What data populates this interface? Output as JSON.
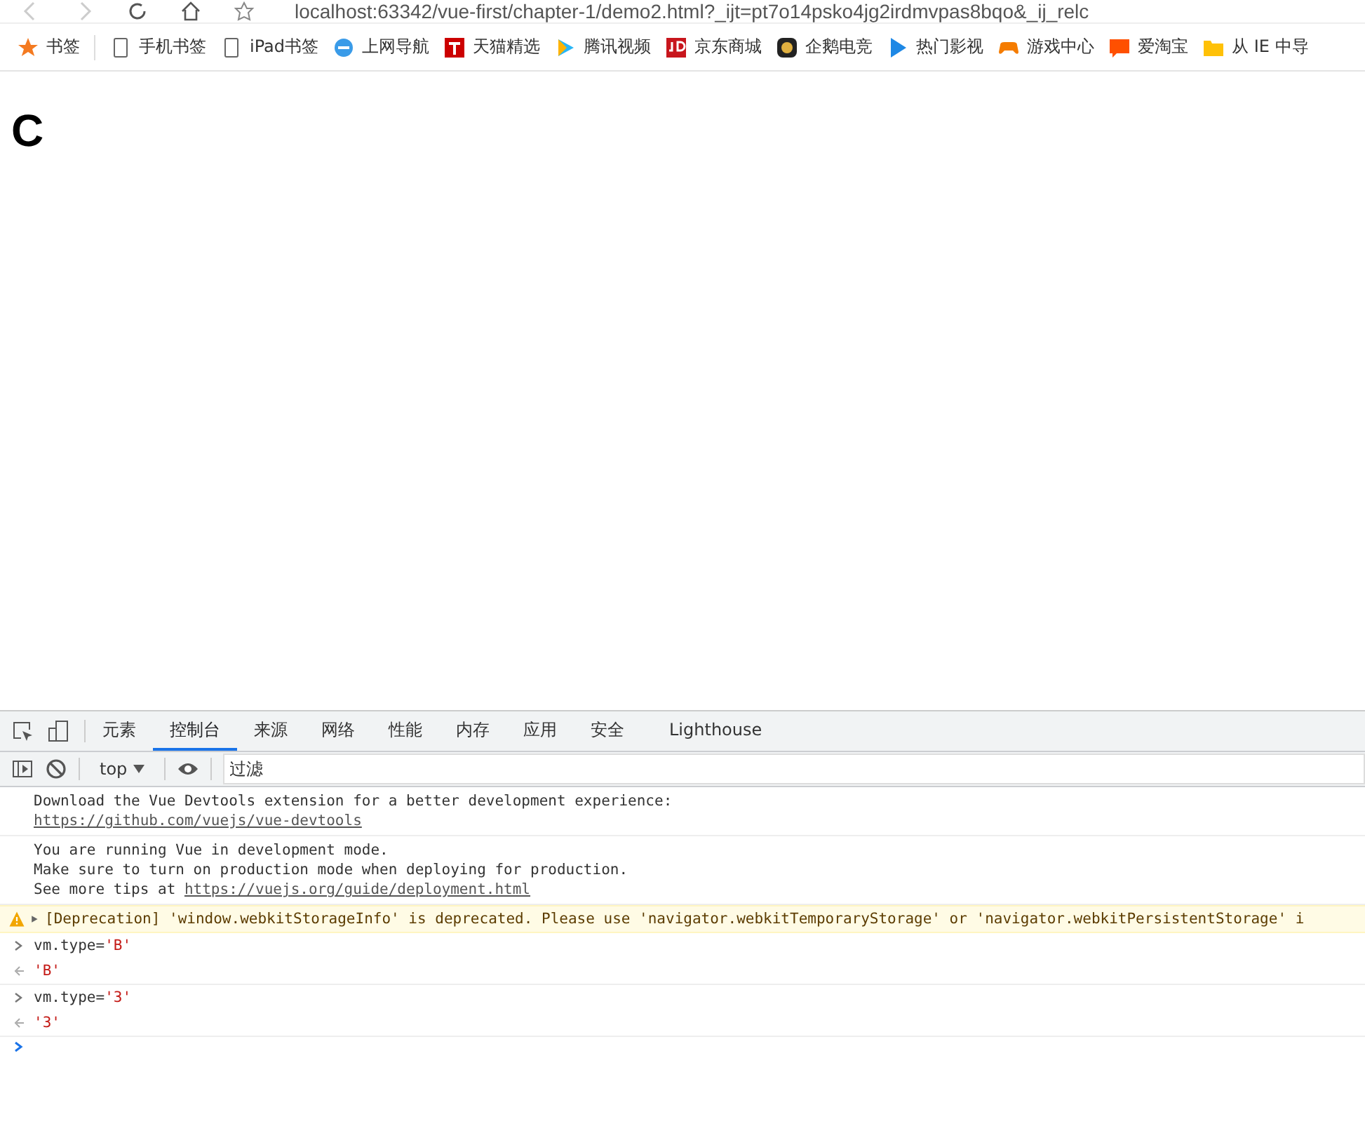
{
  "address_bar": {
    "url": "localhost:63342/vue-first/chapter-1/demo2.html?_ijt=pt7o14psko4jg2irdmvpas8bqo&_ij_relc"
  },
  "bookmarks": [
    {
      "kind": "star",
      "label": "书签"
    },
    {
      "kind": "phone",
      "label": "手机书签"
    },
    {
      "kind": "phone",
      "label": "iPad书签"
    },
    {
      "kind": "ie",
      "label": "上网导航"
    },
    {
      "kind": "tmall",
      "label": "天猫精选"
    },
    {
      "kind": "play",
      "label": "腾讯视频"
    },
    {
      "kind": "jd",
      "label": "京东商城"
    },
    {
      "kind": "badge",
      "label": "企鹅电竞"
    },
    {
      "kind": "arrow",
      "label": "热门影视"
    },
    {
      "kind": "game",
      "label": "游戏中心"
    },
    {
      "kind": "tao",
      "label": "爱淘宝"
    },
    {
      "kind": "folder",
      "label": "从 IE 中导"
    }
  ],
  "page": {
    "heading": "C"
  },
  "devtools": {
    "tabs": [
      {
        "label": "元素",
        "selected": false
      },
      {
        "label": "控制台",
        "selected": true
      },
      {
        "label": "来源",
        "selected": false
      },
      {
        "label": "网络",
        "selected": false
      },
      {
        "label": "性能",
        "selected": false
      },
      {
        "label": "内存",
        "selected": false
      },
      {
        "label": "应用",
        "selected": false
      },
      {
        "label": "安全",
        "selected": false
      },
      {
        "label": "Lighthouse",
        "selected": false
      }
    ],
    "context": "top",
    "filter_placeholder": "过滤",
    "messages": [
      {
        "kind": "log",
        "lines": [
          "Download the Vue Devtools extension for a better development experience:"
        ],
        "link": "https://github.com/vuejs/vue-devtools"
      },
      {
        "kind": "log",
        "lines": [
          "You are running Vue in development mode.",
          "Make sure to turn on production mode when deploying for production."
        ],
        "link_prefix": "See more tips at ",
        "link": "https://vuejs.org/guide/deployment.html"
      },
      {
        "kind": "warning",
        "text": "[Deprecation] 'window.webkitStorageInfo' is deprecated. Please use 'navigator.webkitTemporaryStorage' or 'navigator.webkitPersistentStorage' i"
      },
      {
        "kind": "input",
        "code": "vm.type=",
        "string": "'B'"
      },
      {
        "kind": "result",
        "string": "'B'"
      },
      {
        "kind": "input",
        "code": "vm.type=",
        "string": "'3'"
      },
      {
        "kind": "result",
        "string": "'3'"
      },
      {
        "kind": "prompt"
      }
    ]
  }
}
